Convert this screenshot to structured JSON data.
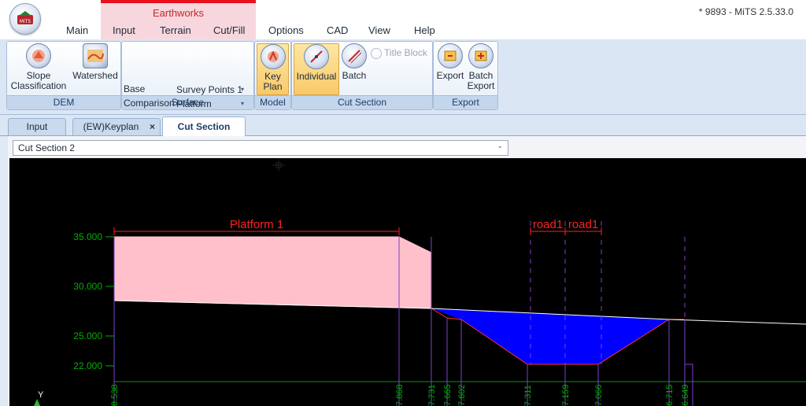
{
  "window": {
    "title": "* 9893 - MiTS 2.5.33.0"
  },
  "ribbon_tabs": {
    "main": "Main",
    "input": "Input",
    "terrain": "Terrain",
    "cutfill": "Cut/Fill",
    "options": "Options",
    "cad": "CAD",
    "view": "View",
    "help": "Help",
    "context_group": "Earthworks"
  },
  "dem_group": {
    "label": "DEM",
    "slope_classification_line1": "Slope",
    "slope_classification_line2": "Classification",
    "slope_arrow": "▾",
    "watershed": "Watershed"
  },
  "surface_group": {
    "label": "Surface",
    "base_label": "Base",
    "base_value": "Survey Points 1",
    "comparison_label": "Comparison",
    "comparison_value": "Platform",
    "arrow": "▾"
  },
  "model_group": {
    "label": "Model",
    "key_line1": "Key",
    "key_line2": "Plan"
  },
  "cut_section_group": {
    "label": "Cut Section",
    "individual": "Individual",
    "batch": "Batch",
    "title_block": "Title Block"
  },
  "export_group": {
    "label": "Export",
    "export": "Export",
    "batch_export_line1": "Batch",
    "batch_export_line2": "Export"
  },
  "doc_tabs": {
    "input": "Input",
    "keyplan": "(EW)Keyplan",
    "keyplan_close": "×",
    "cut_section": "Cut Section"
  },
  "section_select": {
    "value": "Cut Section 2",
    "arrow": "⌄"
  },
  "section_view": {
    "elev_labels": [
      "35.000",
      "30.000",
      "25.000",
      "22.000"
    ],
    "platform_label": "Platform 1",
    "road_labels": [
      "road1",
      "road1"
    ],
    "station_labels": [
      "8.538",
      "7.868",
      "7.731",
      "7.665",
      "7.602",
      "7.311",
      "7.159",
      "7.066",
      "6.715",
      "6.649"
    ],
    "axis_y_label": "Y",
    "colors": {
      "platform_fill": "#ffc0cb",
      "cut_fill": "#0000ff",
      "ground_line": "#ffffff",
      "dimension": "#ff2020",
      "elevation_text": "#00b000",
      "station_line": "#7b3fd1"
    }
  }
}
